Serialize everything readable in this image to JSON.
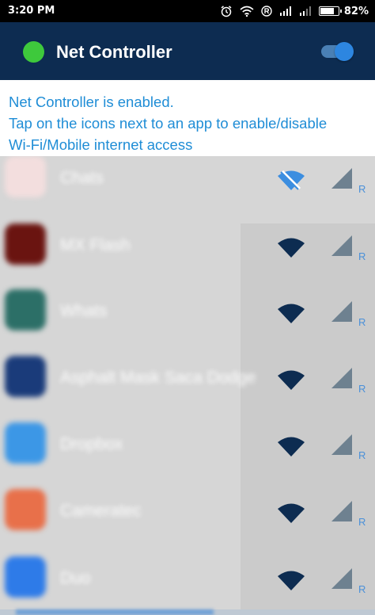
{
  "status_bar": {
    "time": "3:20 PM",
    "battery_percent": "82%",
    "battery_level": 0.82,
    "icons": [
      "alarm-icon",
      "wifi-icon",
      "registered-icon",
      "signal-icon",
      "signal-icon",
      "battery-icon"
    ]
  },
  "app_bar": {
    "title": "Net Controller",
    "status_color": "#3ec93c",
    "master_enabled": true
  },
  "info": {
    "line1": "Net Controller is enabled.",
    "line2": "Tap on the icons next to an app to enable/disable",
    "line3": "Wi-Fi/Mobile internet access"
  },
  "apps": [
    {
      "name": "Chats",
      "icon_color": "#f3dede",
      "wifi_enabled": false,
      "mobile_enabled": true,
      "roaming_label": "R"
    },
    {
      "name": "MX Flash",
      "icon_color": "#6a1410",
      "wifi_enabled": true,
      "mobile_enabled": true,
      "roaming_label": "R"
    },
    {
      "name": "Whats",
      "icon_color": "#2c6f67",
      "wifi_enabled": true,
      "mobile_enabled": true,
      "roaming_label": "R"
    },
    {
      "name": "Asphalt Mask Saca Dodge",
      "icon_color": "#1a3b7a",
      "wifi_enabled": true,
      "mobile_enabled": true,
      "roaming_label": "R"
    },
    {
      "name": "Dropbox",
      "icon_color": "#3c97e6",
      "wifi_enabled": true,
      "mobile_enabled": true,
      "roaming_label": "R"
    },
    {
      "name": "Cameratec",
      "icon_color": "#e8704a",
      "wifi_enabled": true,
      "mobile_enabled": true,
      "roaming_label": "R"
    },
    {
      "name": "Duo",
      "icon_color": "#2e7be8",
      "wifi_enabled": true,
      "mobile_enabled": true,
      "roaming_label": "R"
    }
  ],
  "colors": {
    "app_bar": "#0d2c51",
    "accent_text": "#1f8dd6",
    "wifi_on": "#0d2c51",
    "wifi_off": "#3c8ee0",
    "mobile_icon": "#6e8190",
    "roaming_text": "#4a90d9",
    "toggle_thumb": "#2d86e0"
  }
}
